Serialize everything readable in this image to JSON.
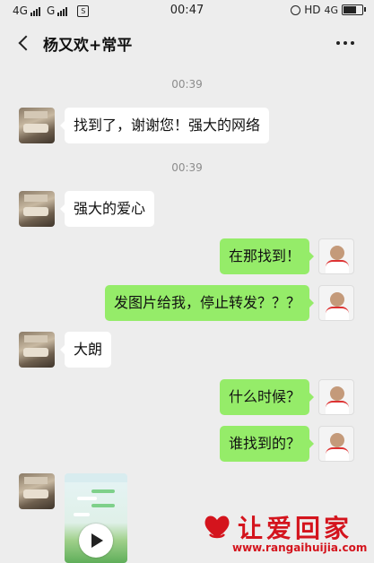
{
  "status_bar": {
    "net1": "4G",
    "net2": "G",
    "sim_glyph": "S",
    "time": "00:47",
    "hd": "HD",
    "net3": "4G",
    "battery_level": 0.85
  },
  "header": {
    "title": "杨又欢+常平",
    "back_icon": "back-arrow-icon",
    "more_icon": "more-dots-icon"
  },
  "messages": [
    {
      "type": "time",
      "text": "00:39"
    },
    {
      "type": "text",
      "side": "left",
      "text": "找到了，谢谢您！强大的网络"
    },
    {
      "type": "time",
      "text": "00:39"
    },
    {
      "type": "text",
      "side": "left",
      "text": "强大的爱心"
    },
    {
      "type": "text",
      "side": "right",
      "text": "在那找到！"
    },
    {
      "type": "text",
      "side": "right",
      "text": "发图片给我，停止转发？？？"
    },
    {
      "type": "text",
      "side": "left",
      "text": "大朗"
    },
    {
      "type": "text",
      "side": "right",
      "text": "什么时候？"
    },
    {
      "type": "text",
      "side": "right",
      "text": "谁找到的？"
    },
    {
      "type": "video",
      "side": "left",
      "icon": "play-icon"
    }
  ],
  "colors": {
    "background": "#ededed",
    "bubble_self": "#95ec69",
    "bubble_other": "#ffffff",
    "watermark": "#d4141d"
  },
  "watermark": {
    "name": "让爱回家",
    "url": "www.rangaihuijia.com"
  }
}
